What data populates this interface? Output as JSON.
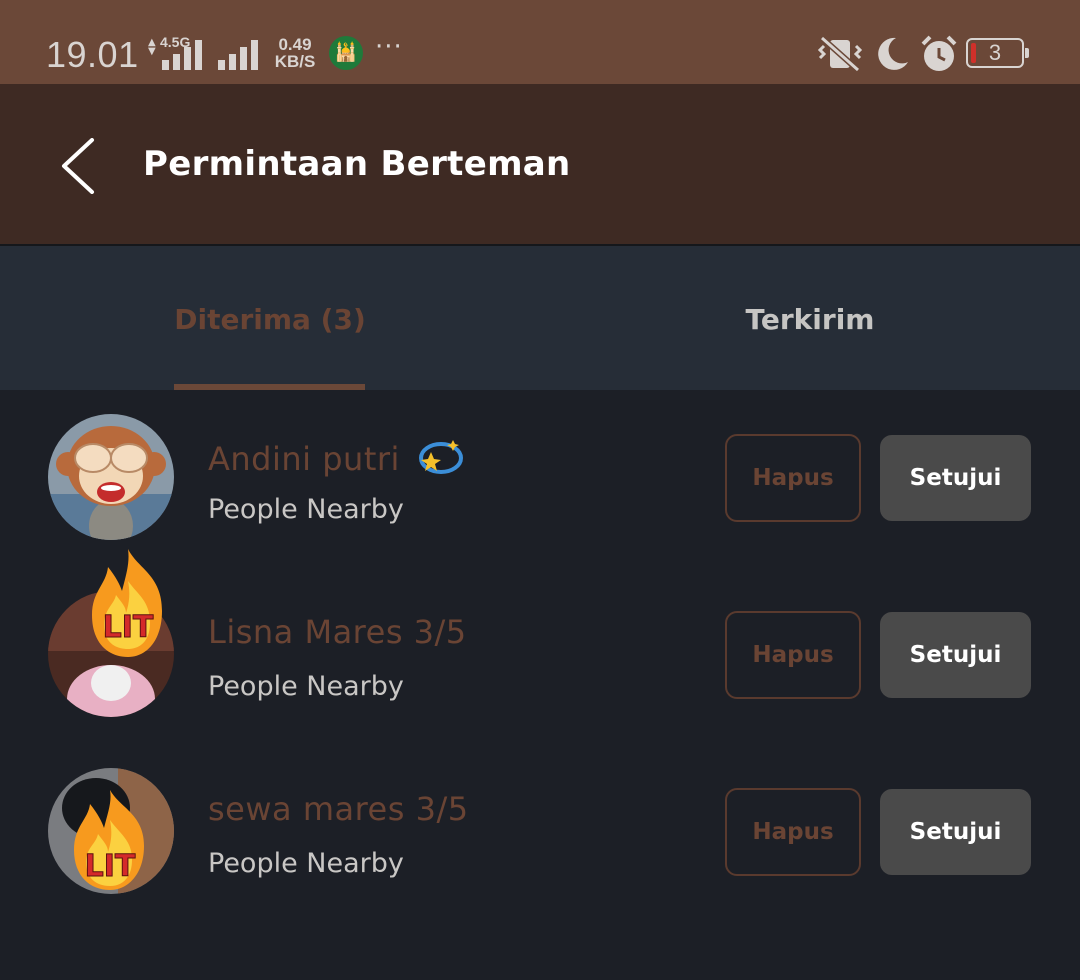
{
  "status_bar": {
    "time": "19.01",
    "network_type": "4.5G",
    "speed_value": "0.49",
    "speed_unit": "KB/S",
    "more": "···",
    "battery_level": "3",
    "icons": [
      "updown-arrows-icon",
      "signal-icon",
      "signal-icon",
      "mosque-app-icon",
      "vibrate-off-icon",
      "moon-icon",
      "alarm-icon",
      "battery-icon"
    ]
  },
  "header": {
    "title": "Permintaan Berteman",
    "back_icon": "chevron-left-icon"
  },
  "tabs": [
    {
      "label": "Diterima (3)",
      "active": true
    },
    {
      "label": "Terkirim",
      "active": false
    }
  ],
  "requests": [
    {
      "name": "Andini putri",
      "badge_icon": "sparkle-emoji-icon",
      "source": "People Nearby",
      "avatar": "monkey-avatar",
      "delete_label": "Hapus",
      "accept_label": "Setujui"
    },
    {
      "name": "Lisna Mares 3/5",
      "source": "People Nearby",
      "avatar": "lit-fire-avatar",
      "delete_label": "Hapus",
      "accept_label": "Setujui"
    },
    {
      "name": "sewa mares 3/5",
      "source": "People Nearby",
      "avatar": "lit-fire-avatar",
      "delete_label": "Hapus",
      "accept_label": "Setujui"
    }
  ],
  "colors": {
    "status_bar": "#6b4838",
    "header": "#3e2a23",
    "tabs_bg": "#262d37",
    "list_bg": "#1c1f26",
    "accent_brown": "#6a4434",
    "accept_button": "#4a4a4a"
  }
}
